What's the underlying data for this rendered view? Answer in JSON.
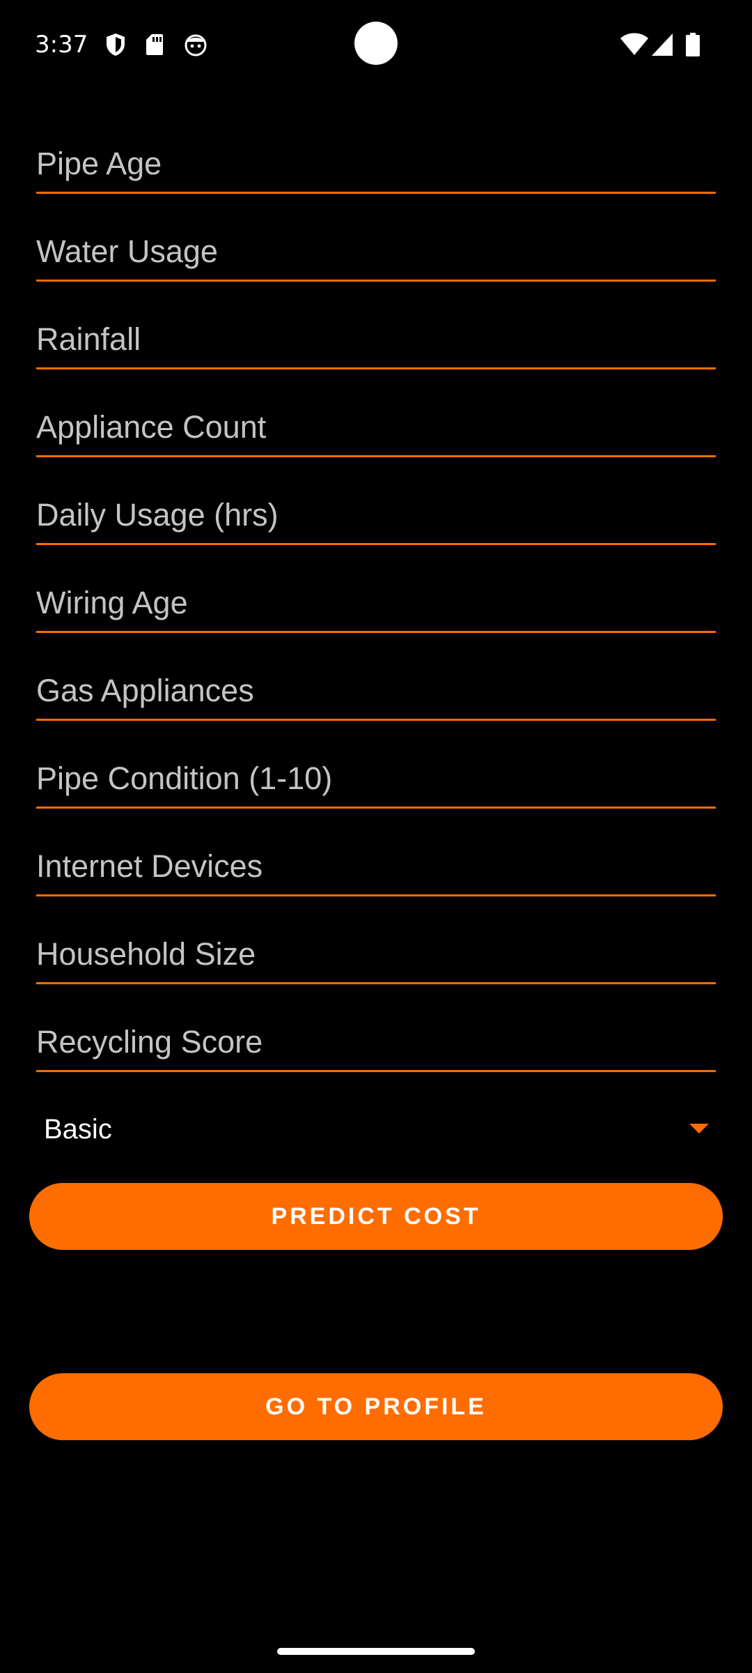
{
  "status_bar": {
    "time": "3:37",
    "icons": [
      "shield-icon",
      "sd-card-icon",
      "face-icon",
      "wifi-icon",
      "signal-icon",
      "battery-icon"
    ]
  },
  "form": {
    "fields": [
      {
        "placeholder": "Pipe Age",
        "value": ""
      },
      {
        "placeholder": "Water Usage",
        "value": ""
      },
      {
        "placeholder": "Rainfall",
        "value": ""
      },
      {
        "placeholder": "Appliance Count",
        "value": ""
      },
      {
        "placeholder": "Daily Usage (hrs)",
        "value": ""
      },
      {
        "placeholder": "Wiring Age",
        "value": ""
      },
      {
        "placeholder": "Gas Appliances",
        "value": ""
      },
      {
        "placeholder": "Pipe Condition (1-10)",
        "value": ""
      },
      {
        "placeholder": "Internet Devices",
        "value": ""
      },
      {
        "placeholder": "Household Size",
        "value": ""
      },
      {
        "placeholder": "Recycling Score",
        "value": ""
      }
    ],
    "plan_select": {
      "selected": "Basic"
    }
  },
  "buttons": {
    "predict_label": "PREDICT COST",
    "profile_label": "GO TO PROFILE"
  },
  "colors": {
    "accent": "#ff6d00",
    "background": "#000000",
    "hint_text": "#c4c4c4"
  }
}
